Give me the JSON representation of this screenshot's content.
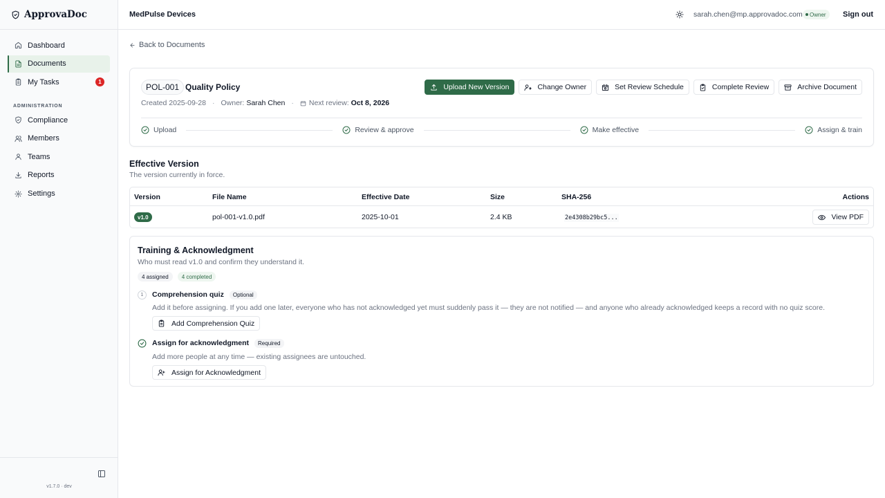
{
  "app": {
    "brand": "ApprovaDoc",
    "version": "v1.7.0 · dev"
  },
  "sidebar": {
    "items": [
      {
        "label": "Dashboard",
        "icon": "home-icon"
      },
      {
        "label": "Documents",
        "icon": "document-icon",
        "active": true
      },
      {
        "label": "My Tasks",
        "icon": "clipboard-icon",
        "badge": "1"
      }
    ],
    "admin_section": "ADMINISTRATION",
    "admin_items": [
      {
        "label": "Compliance",
        "icon": "shield-icon"
      },
      {
        "label": "Members",
        "icon": "users-icon"
      },
      {
        "label": "Teams",
        "icon": "user-group-icon"
      },
      {
        "label": "Reports",
        "icon": "download-icon"
      },
      {
        "label": "Settings",
        "icon": "gear-icon"
      }
    ]
  },
  "header": {
    "org": "MedPulse Devices",
    "email": "sarah.chen@mp.approvadoc.com",
    "role": "Owner",
    "signout": "Sign out"
  },
  "back_link": "Back to Documents",
  "document": {
    "code": "POL-001",
    "title": "Quality Policy",
    "created": "Created 2025-09-28",
    "owner_label": "Owner:",
    "owner_name": "Sarah Chen",
    "next_review_label": "Next review:",
    "next_review_date": "Oct 8, 2026",
    "actions": {
      "upload": "Upload New Version",
      "change_owner": "Change Owner",
      "review_schedule": "Set Review Schedule",
      "complete_review": "Complete Review",
      "archive": "Archive Document"
    },
    "steps": [
      "Upload",
      "Review & approve",
      "Make effective",
      "Assign & train"
    ]
  },
  "effective": {
    "title": "Effective Version",
    "subtitle": "The version currently in force.",
    "columns": {
      "version": "Version",
      "file_name": "File Name",
      "effective_date": "Effective Date",
      "size": "Size",
      "sha": "SHA-256",
      "actions": "Actions"
    },
    "row": {
      "version": "v1.0",
      "file_name": "pol-001-v1.0.pdf",
      "effective_date": "2025-10-01",
      "size": "2.4 KB",
      "sha": "2e4308b29bc5...",
      "view": "View PDF"
    }
  },
  "training": {
    "title": "Training & Acknowledgment",
    "subtitle": "Who must read v1.0 and confirm they understand it.",
    "assigned": "4 assigned",
    "completed": "4 completed",
    "quiz": {
      "number": "1",
      "title": "Comprehension quiz",
      "tag": "Optional",
      "desc": "Add it before assigning. If you add one later, everyone who has not acknowledged yet must suddenly pass it — they are not notified — and anyone who already acknowledged keeps a record with no quiz score.",
      "button": "Add Comprehension Quiz"
    },
    "ack": {
      "title": "Assign for acknowledgment",
      "tag": "Required",
      "desc": "Add more people at any time — existing assignees are untouched.",
      "button": "Assign for Acknowledgment"
    }
  },
  "colors": {
    "accent": "#2f6b48",
    "badge_red": "#dc2626"
  }
}
